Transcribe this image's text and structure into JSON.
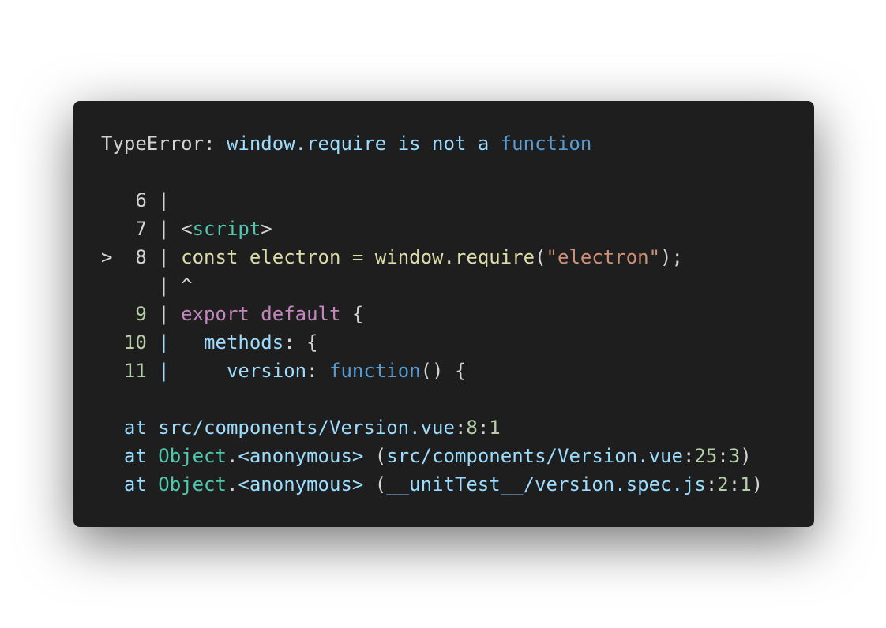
{
  "colors": {
    "plain": "#d4d4d4",
    "prop": "#9cdcfe",
    "keyword": "#569cd6",
    "type": "#4ec9b0",
    "func": "#dcdcaa",
    "string": "#ce9178",
    "control": "#c586c0",
    "number": "#b5cea8"
  },
  "lines": [
    [
      [
        "TypeError: ",
        "plain"
      ],
      [
        "window.require is not a ",
        "prop"
      ],
      [
        "function",
        "keyword"
      ]
    ],
    [],
    [
      [
        "   6 | ",
        "plain"
      ]
    ],
    [
      [
        "   7 | <",
        "plain"
      ],
      [
        "script",
        "type"
      ],
      [
        ">",
        "plain"
      ]
    ],
    [
      [
        ">  8 | ",
        "plain"
      ],
      [
        "const electron = window.",
        "func"
      ],
      [
        "require",
        "func"
      ],
      [
        "(",
        "plain"
      ],
      [
        "\"electron\"",
        "string"
      ],
      [
        ");",
        "plain"
      ]
    ],
    [
      [
        "     | ^",
        "plain"
      ]
    ],
    [
      [
        "   9",
        "number"
      ],
      [
        " | ",
        "plain"
      ],
      [
        "export default",
        "control"
      ],
      [
        " {",
        "plain"
      ]
    ],
    [
      [
        "  10",
        "number"
      ],
      [
        " |   ",
        "prop"
      ],
      [
        "methods",
        "prop"
      ],
      [
        ": {",
        "plain"
      ]
    ],
    [
      [
        "  11",
        "number"
      ],
      [
        " |     ",
        "prop"
      ],
      [
        "version",
        "prop"
      ],
      [
        ": ",
        "plain"
      ],
      [
        "function",
        "keyword"
      ],
      [
        "() {",
        "plain"
      ]
    ],
    [],
    [
      [
        "  at ",
        "prop"
      ],
      [
        "src/components/Version.vue",
        "prop"
      ],
      [
        ":",
        "plain"
      ],
      [
        "8",
        "number"
      ],
      [
        ":",
        "plain"
      ],
      [
        "1",
        "number"
      ]
    ],
    [
      [
        "  at ",
        "prop"
      ],
      [
        "Object",
        "type"
      ],
      [
        ".",
        "plain"
      ],
      [
        "<anonymous>",
        "prop"
      ],
      [
        " (",
        "plain"
      ],
      [
        "src/components/Version.vue",
        "prop"
      ],
      [
        ":",
        "plain"
      ],
      [
        "25",
        "number"
      ],
      [
        ":",
        "plain"
      ],
      [
        "3",
        "number"
      ],
      [
        ")",
        "plain"
      ]
    ],
    [
      [
        "  at ",
        "prop"
      ],
      [
        "Object",
        "type"
      ],
      [
        ".",
        "plain"
      ],
      [
        "<anonymous>",
        "prop"
      ],
      [
        " (",
        "plain"
      ],
      [
        "__unitTest__/version.spec.js",
        "prop"
      ],
      [
        ":",
        "plain"
      ],
      [
        "2",
        "number"
      ],
      [
        ":",
        "plain"
      ],
      [
        "1",
        "number"
      ],
      [
        ")",
        "plain"
      ]
    ]
  ]
}
